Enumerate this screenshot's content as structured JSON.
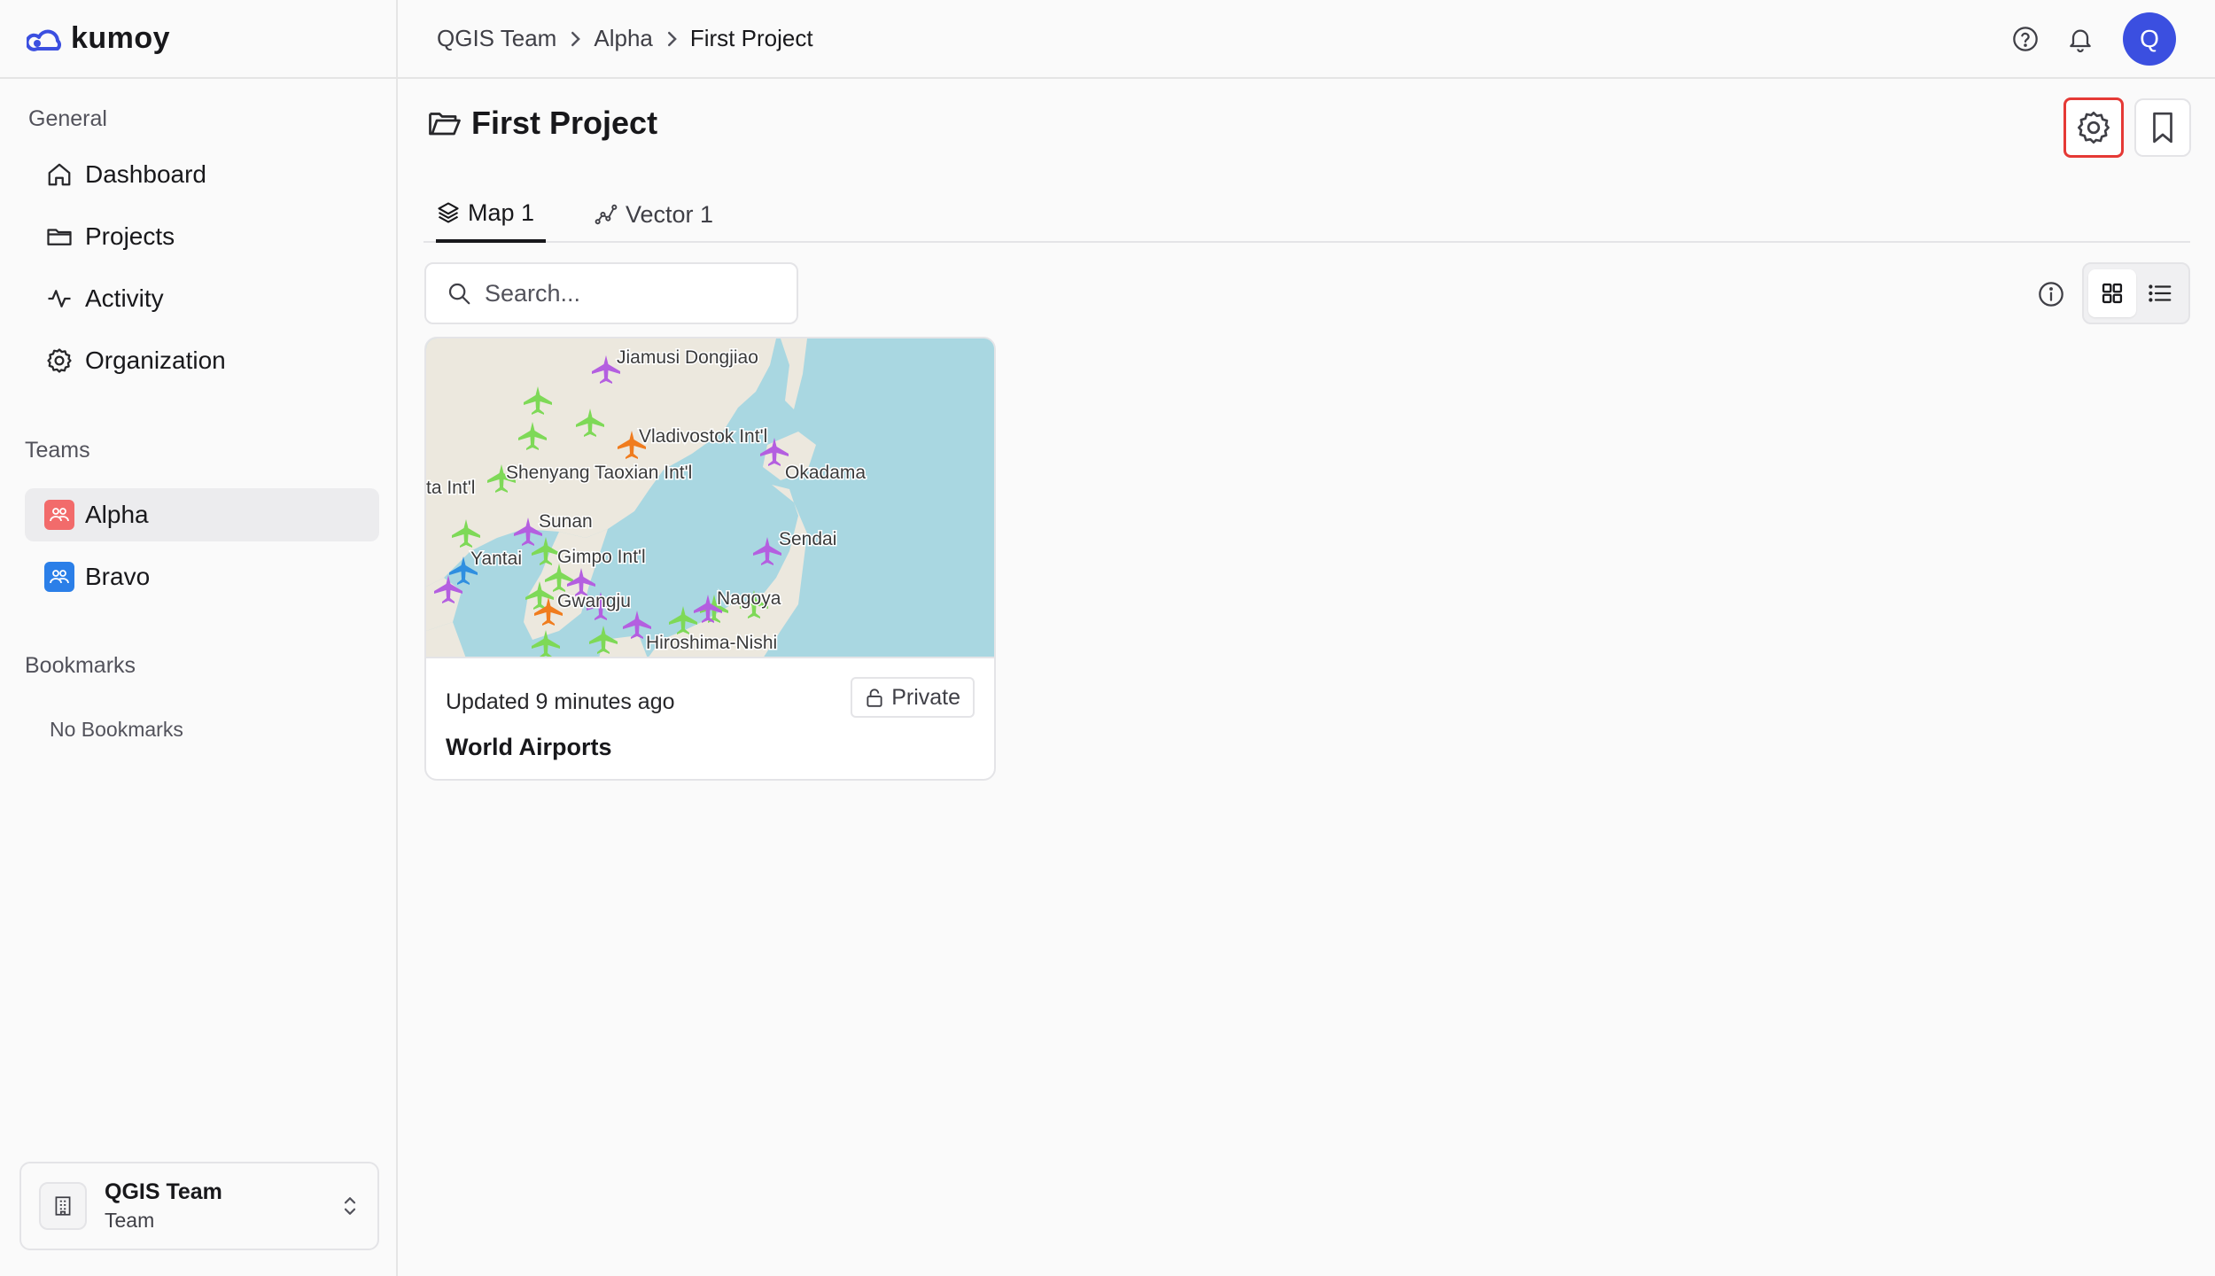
{
  "app": {
    "name": "kumoy"
  },
  "sidebar": {
    "general_label": "General",
    "general_items": [
      {
        "label": "Dashboard",
        "icon": "home-icon"
      },
      {
        "label": "Projects",
        "icon": "folder-icon"
      },
      {
        "label": "Activity",
        "icon": "activity-icon"
      },
      {
        "label": "Organization",
        "icon": "gear-icon"
      }
    ],
    "teams_label": "Teams",
    "teams": [
      {
        "label": "Alpha",
        "color": "#f26b6b",
        "active": true
      },
      {
        "label": "Bravo",
        "color": "#2b7fe8",
        "active": false
      }
    ],
    "bookmarks_label": "Bookmarks",
    "no_bookmarks": "No Bookmarks",
    "team_switcher": {
      "name": "QGIS Team",
      "role": "Team"
    }
  },
  "header": {
    "breadcrumb": [
      "QGIS Team",
      "Alpha",
      "First Project"
    ],
    "avatar_initial": "Q"
  },
  "page": {
    "title": "First Project",
    "tabs": [
      {
        "label": "Map 1",
        "icon": "layers-icon",
        "active": true
      },
      {
        "label": "Vector 1",
        "icon": "vector-icon",
        "active": false
      }
    ],
    "search_placeholder": "Search...",
    "view_mode": "grid"
  },
  "cards": [
    {
      "updated": "Updated 9 minutes ago",
      "visibility": "Private",
      "title": "World Airports",
      "map_labels": [
        "Jiamusi Dongjiao",
        "Vladivostok Int'l",
        "Shenyang Taoxian Int'l",
        "Okadama",
        "ta Int'l",
        "Sunan",
        "Sendai",
        "Yantai",
        "Gimpo Int'l",
        "Gwangju",
        "Nagoya",
        "Hiroshima-Nishi"
      ]
    }
  ],
  "colors": {
    "accent": "#3b4fe0",
    "highlight": "#e53935",
    "airport_green": "#7ed957",
    "airport_purple": "#b45fe0",
    "airport_orange": "#f07c1e",
    "airport_blue": "#2f8fe0"
  }
}
